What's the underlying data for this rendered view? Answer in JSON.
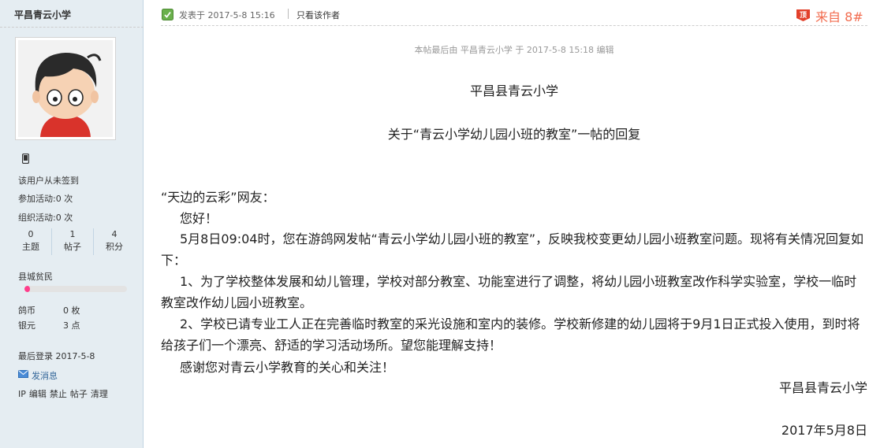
{
  "sidebar": {
    "author": "平昌青云小学",
    "checkin": "该用户从未签到",
    "activity_joined": "参加活动:0 次",
    "activity_organized": "组织活动:0 次",
    "stats": [
      {
        "value": "0",
        "label": "主题"
      },
      {
        "value": "1",
        "label": "帖子"
      },
      {
        "value": "4",
        "label": "积分"
      }
    ],
    "rank": "县城贫民",
    "rank_progress": 0.05,
    "currency_label": "鸽币",
    "currency_value": "0 枚",
    "silver_label": "银元",
    "silver_value": "3 点",
    "last_login": "最后登录  2017-5-8",
    "send_message": "发消息",
    "admin_links": [
      "IP",
      "编辑",
      "禁止",
      "帖子",
      "清理"
    ]
  },
  "post": {
    "posted_at": "发表于 2017-5-8 15:16",
    "only_author": "只看该作者",
    "top_icon": "顶",
    "floor": "来自 8#",
    "edit_note": "本帖最后由 平昌青云小学 于 2017-5-8 15:18 编辑",
    "school": "平昌县青云小学",
    "title": "关于“青云小学幼儿园小班的教室”一帖的回复",
    "salutation": "“天边的云彩”网友：",
    "greeting": "您好！",
    "p1": "5月8日09:04时，您在游鸽网发帖“青云小学幼儿园小班的教室”，反映我校变更幼儿园小班教室问题。现将有关情况回复如下：",
    "p2": "1、为了学校整体发展和幼儿管理，学校对部分教室、功能室进行了调整，将幼儿园小班教室改作科学实验室，学校一临时教室改作幼儿园小班教室。",
    "p3": "2、学校已请专业工人正在完善临时教室的采光设施和室内的装修。学校新修建的幼儿园将于9月1日正式投入使用，到时将给孩子们一个漂亮、舒适的学习活动场所。望您能理解支持！",
    "closing": "感谢您对青云小学教育的关心和关注！",
    "signature": "平昌县青云小学",
    "date": "2017年5月8日"
  },
  "colors": {
    "sidebar_bg": "#e5edf2",
    "floor_accent": "#f26c4f",
    "rank_fill": "#ff3d8b",
    "link": "#336699"
  }
}
